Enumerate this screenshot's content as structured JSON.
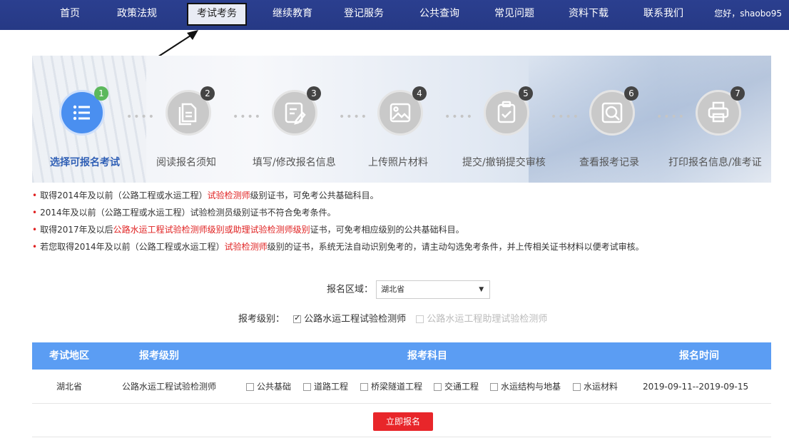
{
  "nav": {
    "items": [
      "首页",
      "政策法规",
      "考试考务",
      "继续教育",
      "登记服务",
      "公共查询",
      "常见问题",
      "资料下载",
      "联系我们"
    ],
    "active_index": 2,
    "user": "您好，shaobo95",
    "bg_color": "#2b3f8f"
  },
  "steps": [
    {
      "num": "1",
      "label": "选择可报名考试",
      "icon": "list-icon",
      "active": true
    },
    {
      "num": "2",
      "label": "阅读报名须知",
      "icon": "document-icon",
      "active": false
    },
    {
      "num": "3",
      "label": "填写/修改报名信息",
      "icon": "edit-form-icon",
      "active": false
    },
    {
      "num": "4",
      "label": "上传照片材料",
      "icon": "image-icon",
      "active": false
    },
    {
      "num": "5",
      "label": "提交/撤销提交审核",
      "icon": "clipboard-check-icon",
      "active": false
    },
    {
      "num": "6",
      "label": "查看报考记录",
      "icon": "magnifier-icon",
      "active": false
    },
    {
      "num": "7",
      "label": "打印报名信息/准考证",
      "icon": "printer-icon",
      "active": false
    }
  ],
  "notes": [
    {
      "pre": "取得2014年及以前（公路工程或水运工程）",
      "red": "试验检测师",
      "post": "级别证书，可免考公共基础科目。"
    },
    {
      "pre": "2014年及以前（公路工程或水运工程）试验检测员级别证书不符合免考条件。",
      "red": "",
      "post": ""
    },
    {
      "pre": "取得2017年及以后",
      "red": "公路水运工程试验检测师级别或助理试验检测师级别",
      "post": "证书，可免考相应级别的公共基础科目。"
    },
    {
      "pre": "若您取得2014年及以前（公路工程或水运工程）",
      "red": "试验检测师",
      "post": "级别的证书，系统无法自动识别免考的，请主动勾选免考条件，并上传相关证书材料以便考试审核。"
    }
  ],
  "form": {
    "region_label": "报名区域：",
    "region_value": "湖北省",
    "level_label": "报考级别：",
    "level_options": [
      {
        "label": "公路水运工程试验检测师",
        "checked": true,
        "enabled": true
      },
      {
        "label": "公路水运工程助理试验检测师",
        "checked": false,
        "enabled": false
      }
    ]
  },
  "table": {
    "headers": [
      "考试地区",
      "报考级别",
      "报考科目",
      "报名时间"
    ],
    "header_color": "#5b9df3",
    "row": {
      "region": "湖北省",
      "level": "公路水运工程试验检测师",
      "subjects": [
        "公共基础",
        "道路工程",
        "桥梁隧道工程",
        "交通工程",
        "水运结构与地基",
        "水运材料"
      ],
      "time": "2019-09-11--2019-09-15"
    }
  },
  "submit_label": "立即报名",
  "submit_color": "#e8262a"
}
